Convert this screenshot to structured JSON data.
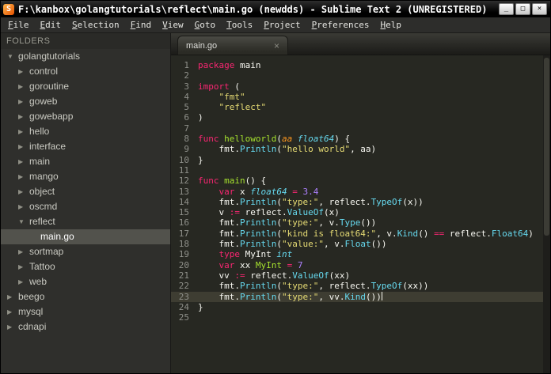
{
  "window": {
    "title": "F:\\kanbox\\golangtutorials\\reflect\\main.go (newdds) - Sublime Text 2 (UNREGISTERED)",
    "controls": {
      "minimize": "_",
      "maximize": "□",
      "close": "×"
    }
  },
  "icons": {
    "app_logo": "S",
    "tab_close": "×",
    "folder_expanded": "▼",
    "folder_collapsed": "▶"
  },
  "menu": {
    "items": [
      "File",
      "Edit",
      "Selection",
      "Find",
      "View",
      "Goto",
      "Tools",
      "Project",
      "Preferences",
      "Help"
    ]
  },
  "sidebar": {
    "header": "FOLDERS",
    "tree": [
      {
        "label": "golangtutorials",
        "level": 0,
        "kind": "folder",
        "state": "expanded"
      },
      {
        "label": "control",
        "level": 1,
        "kind": "folder",
        "state": "collapsed"
      },
      {
        "label": "goroutine",
        "level": 1,
        "kind": "folder",
        "state": "collapsed"
      },
      {
        "label": "goweb",
        "level": 1,
        "kind": "folder",
        "state": "collapsed"
      },
      {
        "label": "gowebapp",
        "level": 1,
        "kind": "folder",
        "state": "collapsed"
      },
      {
        "label": "hello",
        "level": 1,
        "kind": "folder",
        "state": "collapsed"
      },
      {
        "label": "interface",
        "level": 1,
        "kind": "folder",
        "state": "collapsed"
      },
      {
        "label": "main",
        "level": 1,
        "kind": "folder",
        "state": "collapsed"
      },
      {
        "label": "mango",
        "level": 1,
        "kind": "folder",
        "state": "collapsed"
      },
      {
        "label": "object",
        "level": 1,
        "kind": "folder",
        "state": "collapsed"
      },
      {
        "label": "oscmd",
        "level": 1,
        "kind": "folder",
        "state": "collapsed"
      },
      {
        "label": "reflect",
        "level": 1,
        "kind": "folder",
        "state": "expanded"
      },
      {
        "label": "main.go",
        "level": 2,
        "kind": "file",
        "selected": true
      },
      {
        "label": "sortmap",
        "level": 1,
        "kind": "folder",
        "state": "collapsed"
      },
      {
        "label": "Tattoo",
        "level": 1,
        "kind": "folder",
        "state": "collapsed"
      },
      {
        "label": "web",
        "level": 1,
        "kind": "folder",
        "state": "collapsed"
      },
      {
        "label": "beego",
        "level": 0,
        "kind": "folder",
        "state": "collapsed"
      },
      {
        "label": "mysql",
        "level": 0,
        "kind": "folder",
        "state": "collapsed"
      },
      {
        "label": "cdnapi",
        "level": 0,
        "kind": "folder",
        "state": "collapsed"
      }
    ]
  },
  "tabbar": {
    "tabs": [
      {
        "label": "main.go",
        "active": true
      }
    ]
  },
  "editor": {
    "cursor_line": 23,
    "lines": [
      [
        [
          "k",
          "package"
        ],
        [
          "p",
          " main"
        ]
      ],
      [],
      [
        [
          "k",
          "import"
        ],
        [
          "p",
          " ("
        ]
      ],
      [
        [
          "p",
          "    "
        ],
        [
          "s",
          "\"fmt\""
        ]
      ],
      [
        [
          "p",
          "    "
        ],
        [
          "s",
          "\"reflect\""
        ]
      ],
      [
        [
          "p",
          ")"
        ]
      ],
      [],
      [
        [
          "k",
          "func"
        ],
        [
          "f",
          " helloworld"
        ],
        [
          "p",
          "("
        ],
        [
          "a",
          "aa"
        ],
        [
          "p",
          " "
        ],
        [
          "t",
          "float64"
        ],
        [
          "p",
          ") {"
        ]
      ],
      [
        [
          "p",
          "    fmt."
        ],
        [
          "c",
          "Println"
        ],
        [
          "p",
          "("
        ],
        [
          "s",
          "\"hello world\""
        ],
        [
          "p",
          ", aa)"
        ]
      ],
      [
        [
          "p",
          "}"
        ]
      ],
      [],
      [
        [
          "k",
          "func"
        ],
        [
          "f",
          " main"
        ],
        [
          "p",
          "() {"
        ]
      ],
      [
        [
          "p",
          "    "
        ],
        [
          "k",
          "var"
        ],
        [
          "p",
          " x "
        ],
        [
          "t",
          "float64"
        ],
        [
          "o",
          " = "
        ],
        [
          "n",
          "3.4"
        ]
      ],
      [
        [
          "p",
          "    fmt."
        ],
        [
          "c",
          "Println"
        ],
        [
          "p",
          "("
        ],
        [
          "s",
          "\"type:\""
        ],
        [
          "p",
          ", reflect."
        ],
        [
          "c",
          "TypeOf"
        ],
        [
          "p",
          "(x))"
        ]
      ],
      [
        [
          "p",
          "    v "
        ],
        [
          "o",
          ":="
        ],
        [
          "p",
          " reflect."
        ],
        [
          "c",
          "ValueOf"
        ],
        [
          "p",
          "(x)"
        ]
      ],
      [
        [
          "p",
          "    fmt."
        ],
        [
          "c",
          "Println"
        ],
        [
          "p",
          "("
        ],
        [
          "s",
          "\"type:\""
        ],
        [
          "p",
          ", v."
        ],
        [
          "c",
          "Type"
        ],
        [
          "p",
          "())"
        ]
      ],
      [
        [
          "p",
          "    fmt."
        ],
        [
          "c",
          "Println"
        ],
        [
          "p",
          "("
        ],
        [
          "s",
          "\"kind is float64:\""
        ],
        [
          "p",
          ", v."
        ],
        [
          "c",
          "Kind"
        ],
        [
          "p",
          "() "
        ],
        [
          "o",
          "=="
        ],
        [
          "p",
          " reflect."
        ],
        [
          "c",
          "Float64"
        ],
        [
          "p",
          ")"
        ]
      ],
      [
        [
          "p",
          "    fmt."
        ],
        [
          "c",
          "Println"
        ],
        [
          "p",
          "("
        ],
        [
          "s",
          "\"value:\""
        ],
        [
          "p",
          ", v."
        ],
        [
          "c",
          "Float"
        ],
        [
          "p",
          "())"
        ]
      ],
      [
        [
          "p",
          "    "
        ],
        [
          "k",
          "type"
        ],
        [
          "p",
          " MyInt "
        ],
        [
          "t",
          "int"
        ]
      ],
      [
        [
          "p",
          "    "
        ],
        [
          "k",
          "var"
        ],
        [
          "p",
          " xx "
        ],
        [
          "f",
          "MyInt"
        ],
        [
          "o",
          " = "
        ],
        [
          "n",
          "7"
        ]
      ],
      [
        [
          "p",
          "    vv "
        ],
        [
          "o",
          ":="
        ],
        [
          "p",
          " reflect."
        ],
        [
          "c",
          "ValueOf"
        ],
        [
          "p",
          "(xx)"
        ]
      ],
      [
        [
          "p",
          "    fmt."
        ],
        [
          "c",
          "Println"
        ],
        [
          "p",
          "("
        ],
        [
          "s",
          "\"type:\""
        ],
        [
          "p",
          ", reflect."
        ],
        [
          "c",
          "TypeOf"
        ],
        [
          "p",
          "(xx))"
        ]
      ],
      [
        [
          "p",
          "    fmt."
        ],
        [
          "c",
          "Println"
        ],
        [
          "p",
          "("
        ],
        [
          "s",
          "\"type:\""
        ],
        [
          "p",
          ", vv."
        ],
        [
          "c",
          "Kind"
        ],
        [
          "p",
          "())"
        ]
      ],
      [
        [
          "p",
          "}"
        ]
      ],
      []
    ]
  },
  "theme": {
    "editor_bg": "#272822",
    "editor_fg": "#f8f8f2",
    "keyword": "#f92672",
    "string": "#e6db74",
    "number": "#ae81ff",
    "type": "#66d9ef",
    "function": "#a6e22e",
    "parameter": "#fd971f",
    "gutter": "#8f908a",
    "line_highlight": "#3e3d32",
    "sidebar_bg": "#2f2f2c",
    "selection_bg": "#52524c"
  }
}
